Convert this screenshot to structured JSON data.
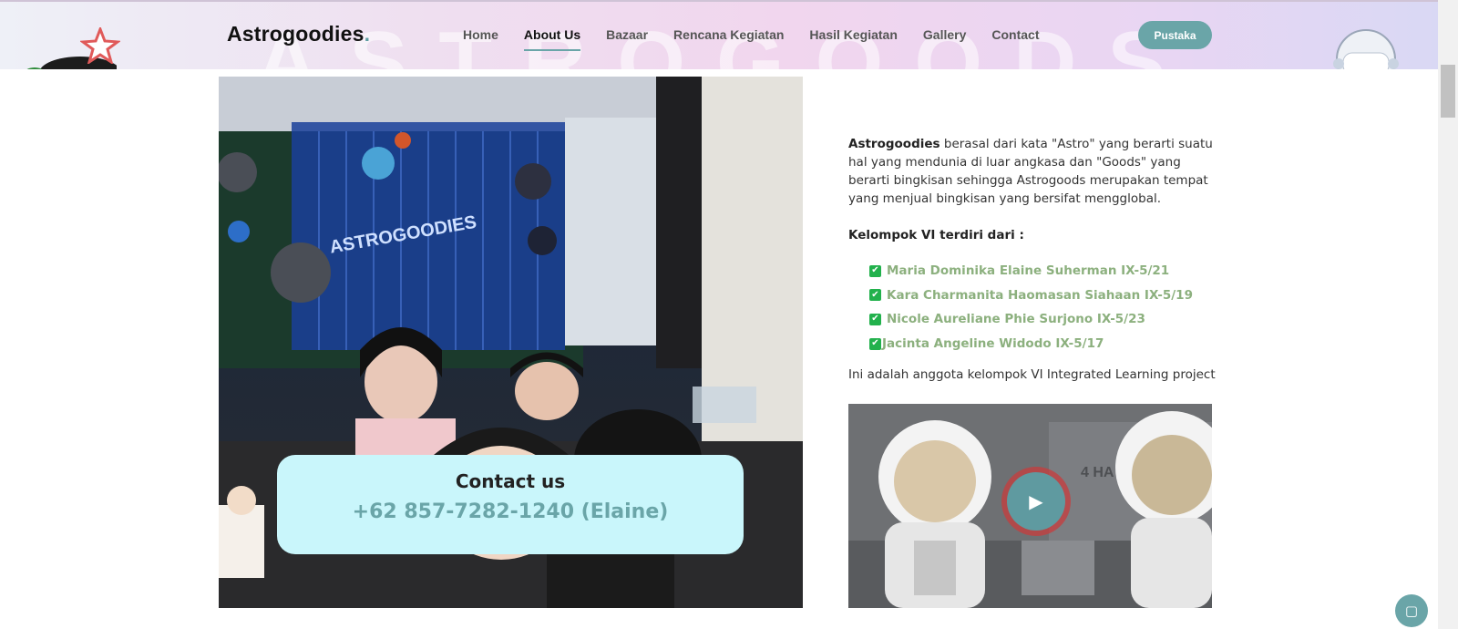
{
  "brand": {
    "name": "Astrogoodies",
    "dot": ".",
    "watermark": "ASTROGOODS"
  },
  "nav": {
    "items": [
      {
        "label": "Home"
      },
      {
        "label": "About Us"
      },
      {
        "label": "Bazaar"
      },
      {
        "label": "Rencana Kegiatan"
      },
      {
        "label": "Hasil Kegiatan"
      },
      {
        "label": "Gallery"
      },
      {
        "label": "Contact"
      }
    ],
    "active": "About Us",
    "cta_label": "Pustaka"
  },
  "photo": {
    "banner_text": "ASTROGOODIES",
    "contact_title": "Contact us",
    "contact_phone": "+62 857-7282-1240 (Elaine)"
  },
  "about": {
    "brand_bold": "Astrogoodies",
    "description": " berasal dari kata \"Astro\" yang berarti suatu hal yang mendunia di luar angkasa dan \"Goods\" yang berarti bingkisan sehingga Astrogoods merupakan tempat yang menjual bingkisan yang bersifat mengglobal.",
    "group_heading": "Kelompok VI terdiri dari :",
    "members": [
      {
        "name": "Maria Dominika Elaine Suherman IX-5/21"
      },
      {
        "name": "Kara Charmanita Haomasan Siahaan IX-5/19"
      },
      {
        "name": "Nicole Aureliane Phie Surjono IX-5/23"
      },
      {
        "name": "Jacinta Angeline Widodo IX-5/17"
      }
    ],
    "note": "Ini adalah anggota kelompok VI Integrated Learning project"
  },
  "video": {
    "panel_text": "4 HA",
    "play_icon": "play-icon"
  },
  "colors": {
    "accent": "#6aa5a8",
    "card": "#c9f6fb",
    "member": "#8cb07e",
    "check": "#22b14c"
  }
}
